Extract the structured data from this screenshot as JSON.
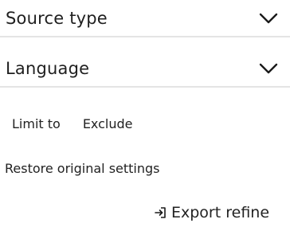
{
  "facets": {
    "source_type": {
      "label": "Source type",
      "icon": "chevron-down-icon"
    },
    "language": {
      "label": "Language",
      "icon": "chevron-down-icon"
    }
  },
  "actions": {
    "limit_to": "Limit to",
    "exclude": "Exclude"
  },
  "restore_label": "Restore original settings",
  "export": {
    "label": "Export refine",
    "icon": "export-icon"
  }
}
